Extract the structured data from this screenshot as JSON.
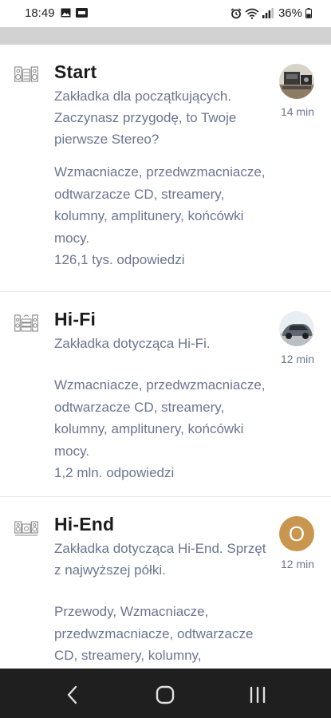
{
  "status_bar": {
    "time": "18:49",
    "left_icons": [
      "image-icon",
      "app-badge-icon"
    ],
    "right_icons": [
      "alarm-icon",
      "wifi-icon",
      "signal-icon"
    ],
    "battery_percent": "36%"
  },
  "forums": [
    {
      "icon": "stereo-speakers-icon",
      "title": "Start",
      "description": "Zakładka dla początkujących. Zaczynasz przygodę, to Twoje pierwsze Stereo?",
      "subforums": "Wzmacniacze, przedwzmacniacze, odtwarzacze CD, streamery, kolumny, amplitunery, końcówki mocy.",
      "count": "126,1 tys. odpowiedzi",
      "avatar": "user-photo-avatar",
      "time_ago": "14 min"
    },
    {
      "icon": "hifi-system-icon",
      "title": "Hi-Fi",
      "description": "Zakładka dotycząca Hi-Fi.",
      "subforums": "Wzmacniacze, przedwzmacniacze, odtwarzacze CD, streamery, kolumny, amplitunery, końcówki mocy.",
      "count": "1,2 mln. odpowiedzi",
      "avatar": "car-photo-avatar",
      "time_ago": "12 min"
    },
    {
      "icon": "hiend-system-icon",
      "title": "Hi-End",
      "description": "Zakładka dotycząca Hi-End. Sprzęt z najwyższej półki.",
      "subforums": "Przewody, Wzmacniacze, przedwzmacniacze, odtwarzacze CD, streamery, kolumny, amplitunery, końcówki mocy.",
      "avatar_letter": "O",
      "time_ago": "12 min"
    }
  ],
  "navigation": {
    "back": "back-icon",
    "home": "home-icon",
    "recent": "recent-apps-icon"
  },
  "colors": {
    "text_muted": "#6b7590",
    "title": "#1c1c1c",
    "avatar_letter_bg": "#c8964e",
    "nav_bar_bg": "#1f1f1f"
  }
}
